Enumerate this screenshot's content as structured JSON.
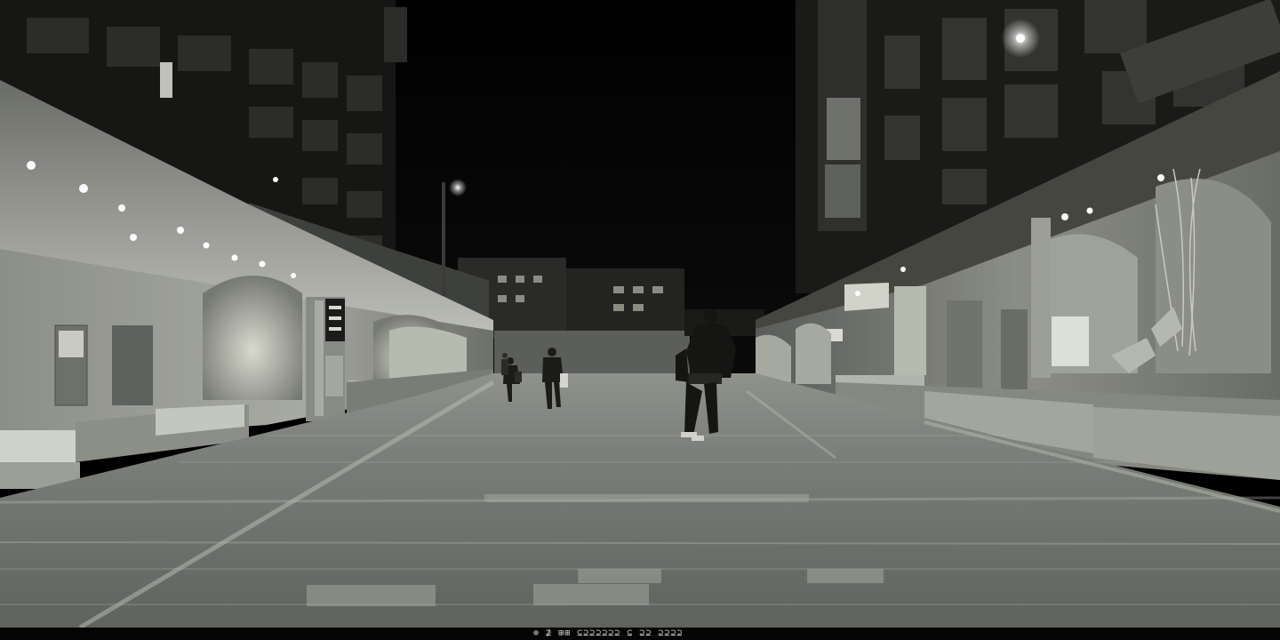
{
  "photo": {
    "scene": "night-pedestrian-street",
    "tone": "desaturated-monochrome",
    "colors": {
      "sky": "#030303",
      "pavement": "#6f726d",
      "wall_glow": "#b9bcb3",
      "lamp": "#ffffff"
    }
  },
  "signage": {
    "left_pole_text": "",
    "right_hanging_text": ""
  },
  "caption": {
    "text": "⊚ ⊉ ⊞⊞ ⊆⊇⊇⊇⊇⊇⊇ ⊆ ⊇⊇ ⊇⊇⊇⊇"
  }
}
